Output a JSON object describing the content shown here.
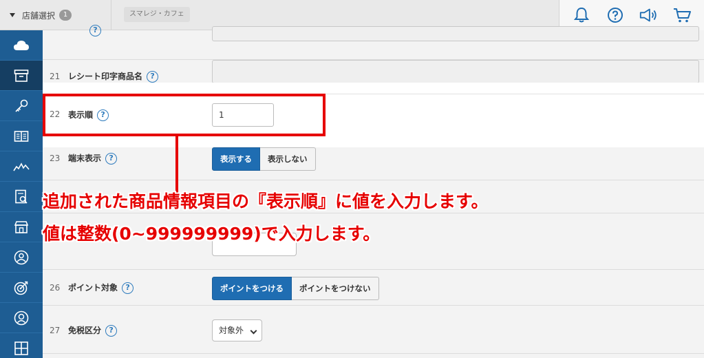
{
  "header": {
    "store_select_label": "店舗選択",
    "store_count": "1",
    "store_name": "スマレジ・カフェ"
  },
  "sidebar": {
    "items": [
      {
        "icon": "cloud-icon"
      },
      {
        "icon": "archive-box-icon",
        "active": true
      },
      {
        "icon": "key-icon"
      },
      {
        "icon": "book-icon"
      },
      {
        "icon": "chart-line-icon"
      },
      {
        "icon": "report-icon"
      },
      {
        "icon": "store-icon"
      },
      {
        "icon": "user-circle-icon"
      },
      {
        "icon": "target-icon"
      },
      {
        "icon": "customer-icon"
      },
      {
        "icon": "grid-icon"
      }
    ]
  },
  "form": {
    "row21": {
      "num": "21",
      "label": "レシート印字商品名"
    },
    "row22": {
      "num": "22",
      "label": "表示順",
      "value": "1"
    },
    "row23": {
      "num": "23",
      "label": "端末表示",
      "opt_on": "表示する",
      "opt_off": "表示しない"
    },
    "row26": {
      "num": "26",
      "label": "ポイント対象",
      "opt_on": "ポイントをつける",
      "opt_off": "ポイントをつけない"
    },
    "row27": {
      "num": "27",
      "label": "免税区分",
      "selected": "対象外"
    },
    "help_glyph": "?"
  },
  "annotation": {
    "line1": "追加された商品情報項目の『表示順』に値を入力します。",
    "line2": "値は整数(0~999999999)で入力します。"
  },
  "colors": {
    "accent": "#1f6db2",
    "sidebar": "#1e5d93",
    "annotation": "#e60000"
  }
}
